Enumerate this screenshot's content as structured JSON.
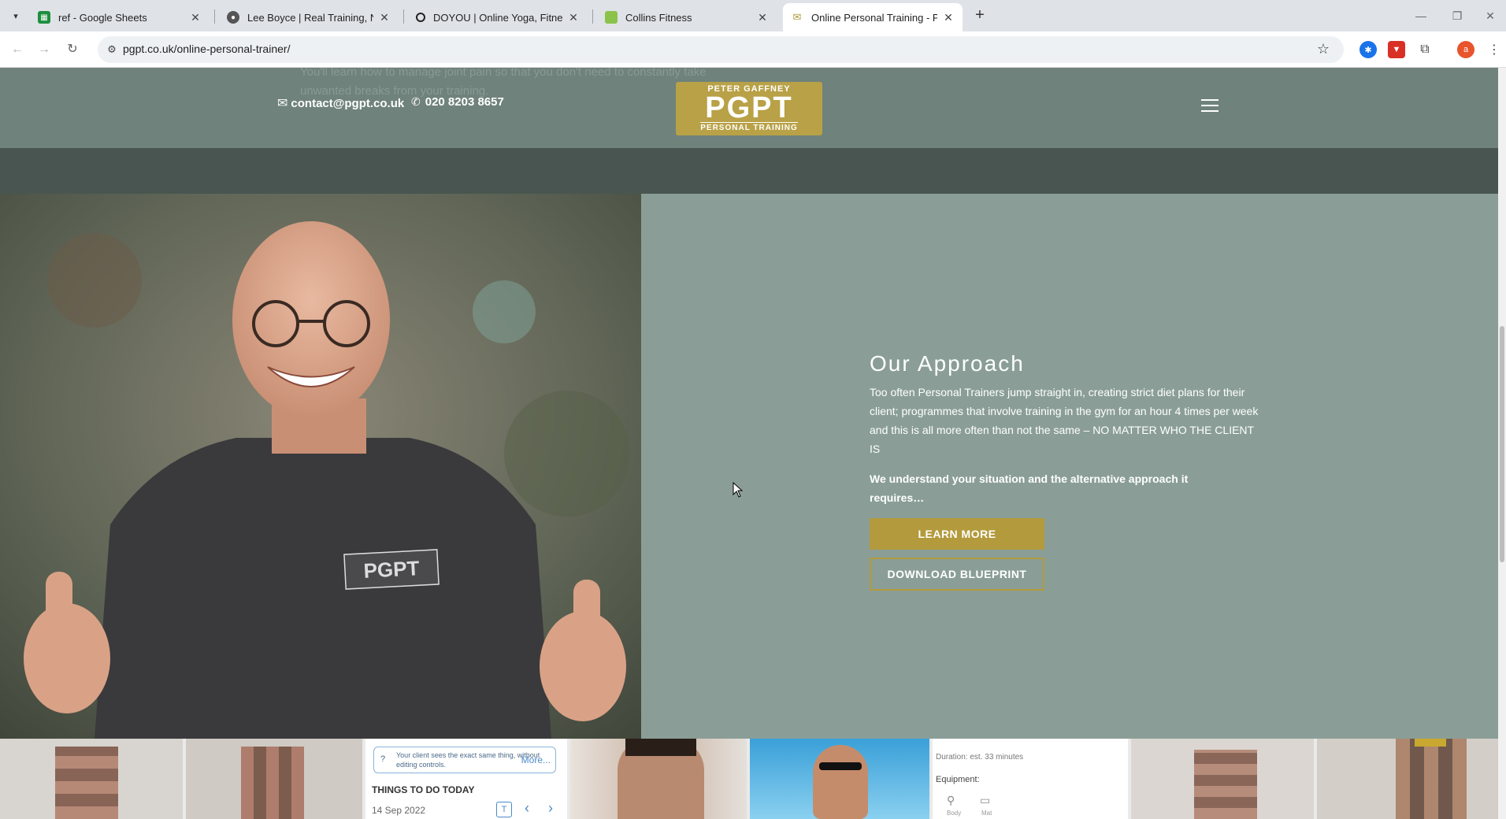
{
  "browser": {
    "tabs": [
      {
        "title": "ref - Google Sheets",
        "favicon": "sheets-icon",
        "active": false
      },
      {
        "title": "Lee Boyce | Real Training, No N",
        "favicon": "person-icon",
        "active": false
      },
      {
        "title": "DOYOU | Online Yoga, Fitness, &",
        "favicon": "circle-icon",
        "active": false
      },
      {
        "title": "Collins Fitness",
        "favicon": "green-square-icon",
        "active": false
      },
      {
        "title": "Online Personal Training - PGPT",
        "favicon": "mail-icon",
        "active": true
      }
    ],
    "url": "pgpt.co.uk/online-personal-trainer/",
    "profile_initial": "a"
  },
  "header": {
    "ghost_text": "You'll learn how to manage joint pain so that you don't need to constantly take unwanted breaks from your training.",
    "email": "contact@pgpt.co.uk",
    "phone": "020 8203 8657",
    "logo": {
      "top": "PETER GAFFNEY",
      "main": "PGPT",
      "bottom": "PERSONAL TRAINING"
    }
  },
  "approach": {
    "title": "Our Approach",
    "body": "Too often Personal Trainers jump straight in, creating strict diet plans for their client; programmes that involve training in the gym for an hour 4 times per week and this is all more often than not the same – NO MATTER WHO THE CLIENT IS",
    "strong": "We understand your situation and the alternative approach it requires…",
    "learn_more": "LEARN MORE",
    "download": "DOWNLOAD BLUEPRINT"
  },
  "strip": {
    "app_notice": "Your client sees the exact same thing, without editing controls.",
    "app_more": "More...",
    "app_heading": "THINGS TO DO TODAY",
    "app_date": "14 Sep 2022",
    "app_duration": "Duration: est. 33 minutes",
    "app_equipment": "Equipment:",
    "app_eq1": "Body",
    "app_eq2": "Mat",
    "shirt_logo": "PGPT"
  },
  "colors": {
    "brand_gold": "#b39a3c",
    "header_bg": "#6f827c",
    "section_bg": "#8a9e97",
    "dark_band": "#485550"
  }
}
